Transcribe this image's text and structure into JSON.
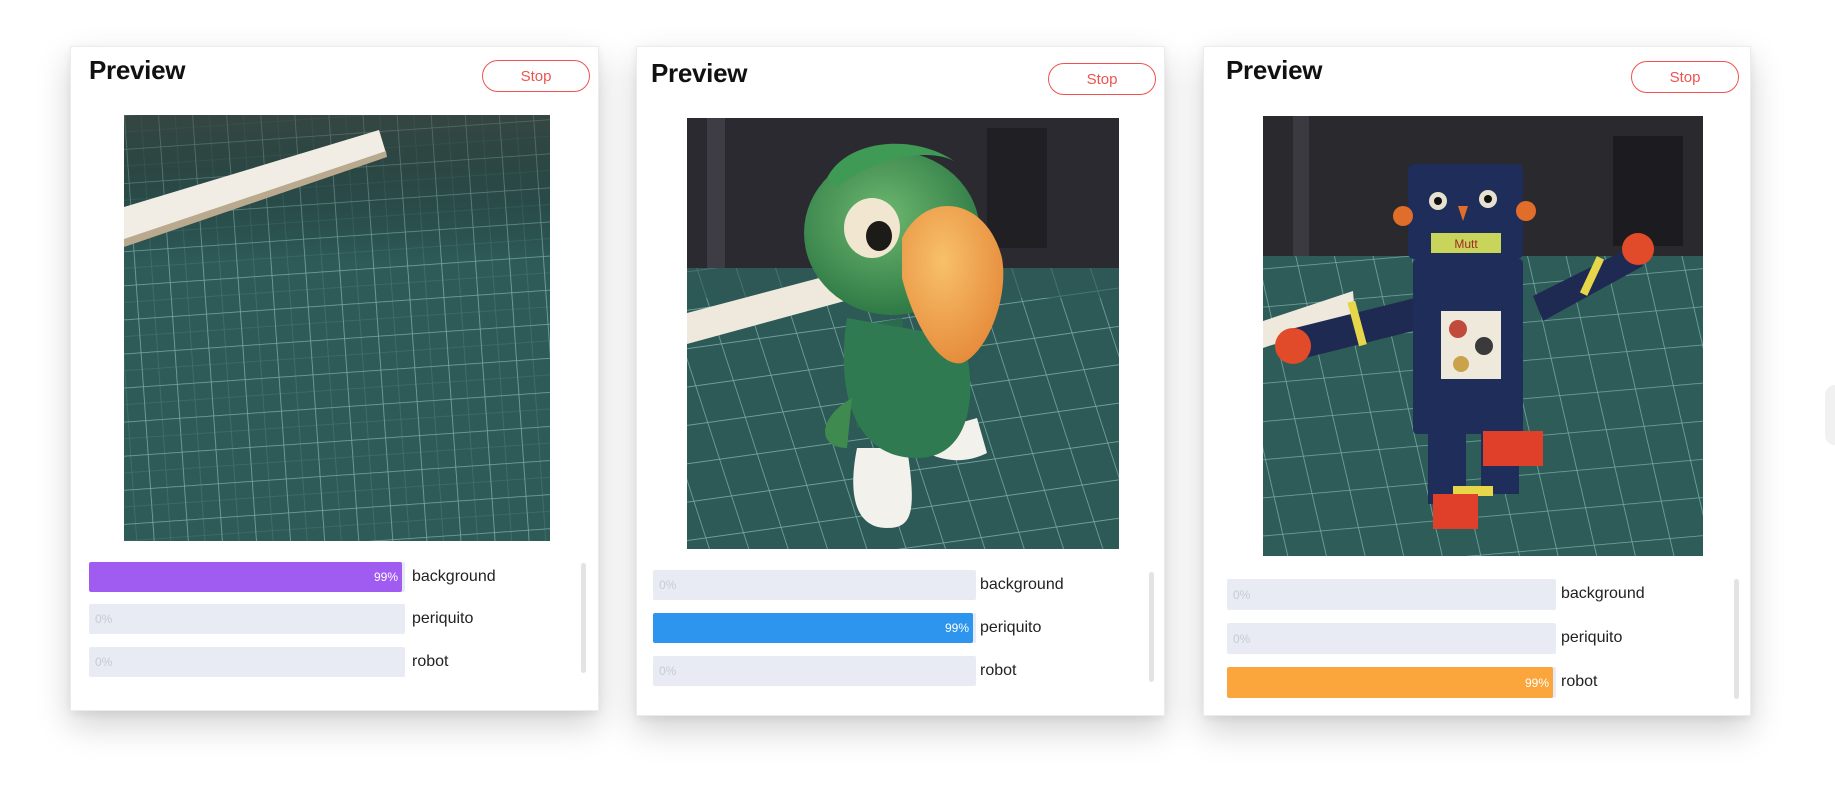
{
  "cards": [
    {
      "title": "Preview",
      "stop_label": "Stop",
      "bars": [
        {
          "label": "background",
          "percent": 99,
          "pct_text": "99%",
          "color": "#a05cf0"
        },
        {
          "label": "periquito",
          "percent": 0,
          "pct_text": "0%",
          "color": "#e8ebf3"
        },
        {
          "label": "robot",
          "percent": 0,
          "pct_text": "0%",
          "color": "#e8ebf3"
        }
      ]
    },
    {
      "title": "Preview",
      "stop_label": "Stop",
      "bars": [
        {
          "label": "background",
          "percent": 0,
          "pct_text": "0%",
          "color": "#e8ebf3"
        },
        {
          "label": "periquito",
          "percent": 99,
          "pct_text": "99%",
          "color": "#2d95ee"
        },
        {
          "label": "robot",
          "percent": 0,
          "pct_text": "0%",
          "color": "#e8ebf3"
        }
      ]
    },
    {
      "title": "Preview",
      "stop_label": "Stop",
      "bars": [
        {
          "label": "background",
          "percent": 0,
          "pct_text": "0%",
          "color": "#e8ebf3"
        },
        {
          "label": "periquito",
          "percent": 0,
          "pct_text": "0%",
          "color": "#e8ebf3"
        },
        {
          "label": "robot",
          "percent": 99,
          "pct_text": "99%",
          "color": "#fba63c"
        }
      ]
    }
  ],
  "accent_colors": {
    "stop": "#ef5350",
    "track": "#e8ebf3"
  },
  "robot_badge_text": "Mutt"
}
